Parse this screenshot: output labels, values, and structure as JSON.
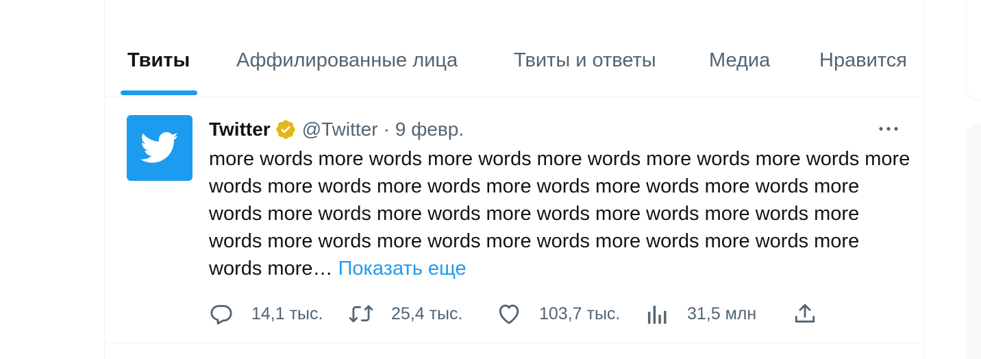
{
  "tabs": [
    {
      "label": "Твиты",
      "active": true
    },
    {
      "label": "Аффилированные лица",
      "active": false
    },
    {
      "label": "Твиты и ответы",
      "active": false
    },
    {
      "label": "Медиа",
      "active": false
    },
    {
      "label": "Нравится",
      "active": false
    }
  ],
  "tweet": {
    "display_name": "Twitter",
    "handle": "@Twitter",
    "separator": "·",
    "date": "9 февр.",
    "text": "more words more words more words more words more words more words more words more words more words more words more words more words more words more words more words more words more words more words more words more words more words more words more words more words more words more…",
    "show_more": "Показать еще",
    "stats": {
      "replies": "14,1 тыс.",
      "retweets": "25,4 тыс.",
      "likes": "103,7 тыс.",
      "views": "31,5 млн"
    }
  },
  "icons": {
    "avatar": "twitter-bird-icon",
    "verified": "gold-verified-badge-icon",
    "more": "more-horizontal-icon",
    "reply": "reply-icon",
    "retweet": "retweet-icon",
    "like": "heart-icon",
    "views": "views-chart-icon",
    "share": "share-icon"
  },
  "colors": {
    "accent": "#1d9bf0",
    "text": "#0f1419",
    "secondary": "#536471",
    "verified_gold": "#e2b719",
    "border": "#eff3f4"
  }
}
